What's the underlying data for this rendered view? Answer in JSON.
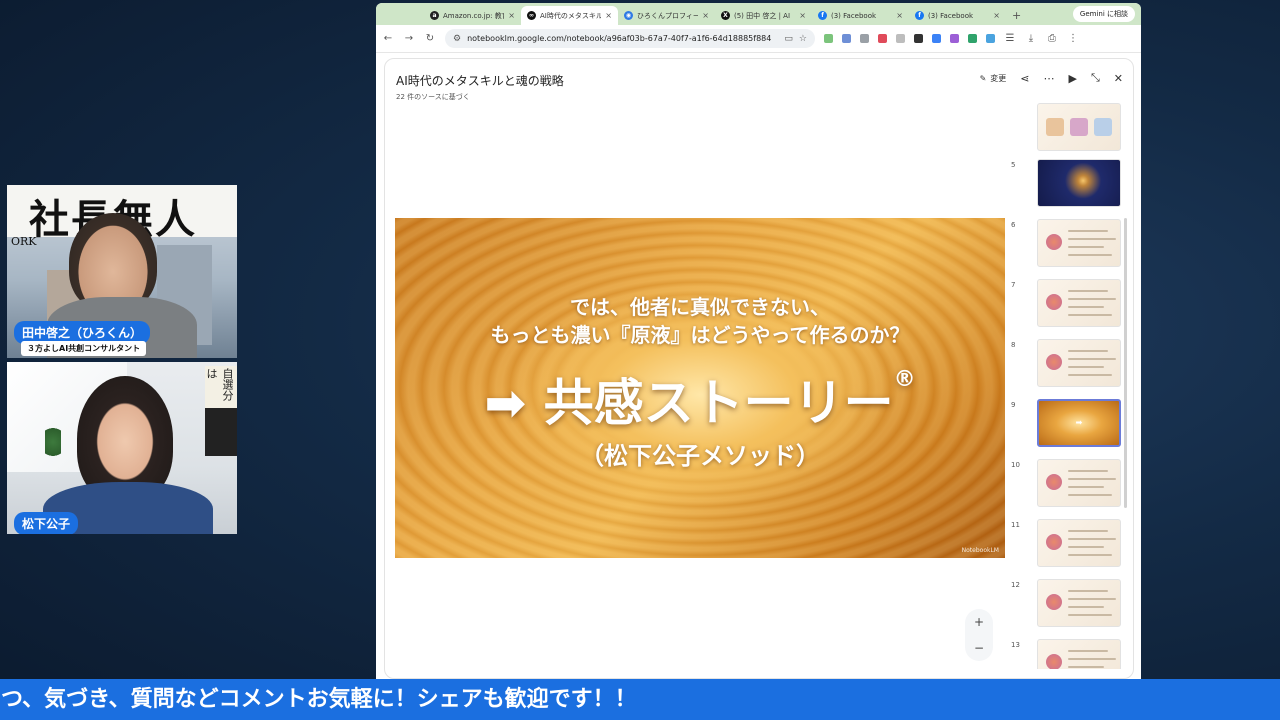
{
  "participants": [
    {
      "name": "田中啓之（ひろくん）",
      "title": "３方よしAI共創コンサルタント",
      "poster_text": "社長無人",
      "poster_small": "ORK"
    },
    {
      "name": "松下公子",
      "book_text": "自選分は"
    }
  ],
  "browser": {
    "tabs": [
      {
        "label": "Amazon.co.jp: 教育",
        "icon": "amazon-icon",
        "color": "#222222",
        "glyph": "a"
      },
      {
        "label": "AI時代のメタスキル",
        "icon": "notebooklm-icon",
        "color": "#111111",
        "glyph": "∞",
        "active": true
      },
      {
        "label": "ひろくんプロフィール",
        "icon": "globe-icon",
        "color": "#2f7ae5",
        "glyph": "◉"
      },
      {
        "label": "(5) 田中 啓之 | AI",
        "icon": "x-icon",
        "color": "#111111",
        "glyph": "X"
      },
      {
        "label": "(3) Facebook",
        "icon": "facebook-icon",
        "color": "#1877f2",
        "glyph": "f"
      },
      {
        "label": "(3) Facebook",
        "icon": "facebook-icon",
        "color": "#1877f2",
        "glyph": "f"
      }
    ],
    "gemini_label": "Gemini に相談",
    "url": "notebooklm.google.com/notebook/a96af03b-67a7-40f7-a1f6-64d18885f884"
  },
  "notebook": {
    "title": "AI時代のメタスキルと魂の戦略",
    "subtitle": "22 件のソースに基づく",
    "edit_label": "変更"
  },
  "slide": {
    "line1": "では、他者に真似できない、",
    "line2": "もっとも濃い『原液』はどうやって作るのか？",
    "main": "➡ 共感ストーリー",
    "main_mark": "®",
    "sub": "（松下公子メソッド）",
    "watermark": "NotebookLM",
    "accent": "#e9a640"
  },
  "thumbnails": [
    {
      "num": "",
      "style": "icons"
    },
    {
      "num": "5",
      "style": "dark"
    },
    {
      "num": "6",
      "style": "light"
    },
    {
      "num": "7",
      "style": "light"
    },
    {
      "num": "8",
      "style": "light"
    },
    {
      "num": "9",
      "style": "gold",
      "active": true
    },
    {
      "num": "10",
      "style": "light"
    },
    {
      "num": "11",
      "style": "light"
    },
    {
      "num": "12",
      "style": "light"
    },
    {
      "num": "13",
      "style": "light"
    }
  ],
  "zoom": {
    "plus": "+",
    "minus": "−"
  },
  "ticker": "つ、気づき、質問などコメントお気軽に！シェアも歓迎です！！",
  "colors": {
    "brand_blue": "#1b6fe0",
    "tab_bar": "#cfe6c8",
    "active_thumb": "#6b7bd8"
  }
}
